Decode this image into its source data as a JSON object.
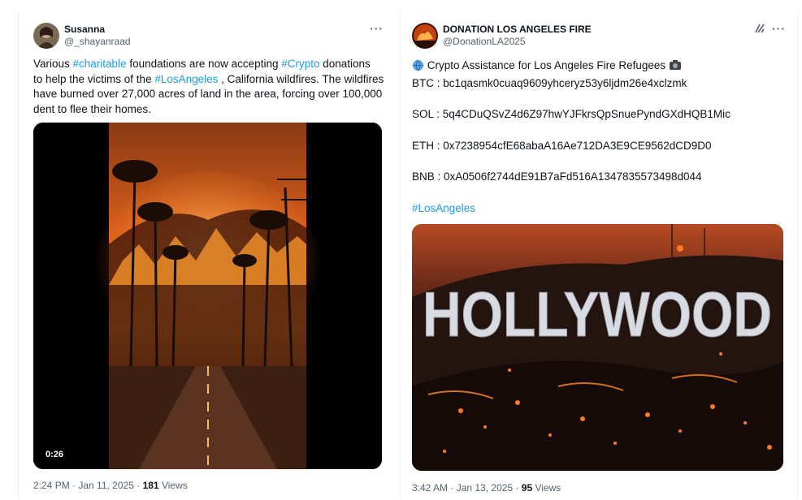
{
  "tweet1": {
    "name": "Susanna",
    "handle": "@_shayanraad",
    "text_lines": [
      [
        {
          "t": "Various "
        },
        {
          "t": "#charitable",
          "tag": true
        },
        {
          "t": " foundations are now accepting "
        },
        {
          "t": "#Crypto",
          "tag": true
        },
        {
          "t": "  donations"
        }
      ],
      [
        {
          "t": "to help the victims of the "
        },
        {
          "t": "#LosAngeles",
          "tag": true
        },
        {
          "t": " , California wildfires. The wildfires"
        }
      ],
      [
        {
          "t": "have burned over 27,000 acres of land in the area, forcing over 100,000"
        }
      ],
      [
        {
          "t": "dent to flee their homes."
        }
      ]
    ],
    "video_duration": "0:26",
    "time": "2:24 PM",
    "date": "Jan 11, 2025",
    "views_count": "181",
    "views_label": "Views"
  },
  "tweet2": {
    "name": "DONATION LOS ANGELES FIRE",
    "handle": "@DonationLA2025",
    "title": "Crypto Assistance for Los Angeles Fire Refugees",
    "btc": "BTC : bc1qasmk0cuaq9609yhceryz53y6ljdm26e4xclzmk",
    "sol": "SOL : 5q4CDuQSvZ4d6Z97hwYJFkrsQpSnuePyndGXdHQB1Mic",
    "eth": "ETH : 0x7238954cfE68abaA16Ae712DA3E9CE9562dCD9D0",
    "bnb": "BNB : 0xA0506f2744dE91B7aFd516A1347835573498d044",
    "hashtag": "#LosAngeles",
    "image_text": "HOLLYWOOD",
    "time": "3:42 AM",
    "date": "Jan 13, 2025",
    "views_count": "95",
    "views_label": "Views"
  },
  "icons": {
    "more": "more-horizontal-icon",
    "grok": "grok-icon",
    "globe": "globe-icon",
    "camera": "camera-icon"
  },
  "colors": {
    "hashtag": "#1d9bf0",
    "secondary_text": "#536471",
    "primary_text": "#0f1419"
  }
}
